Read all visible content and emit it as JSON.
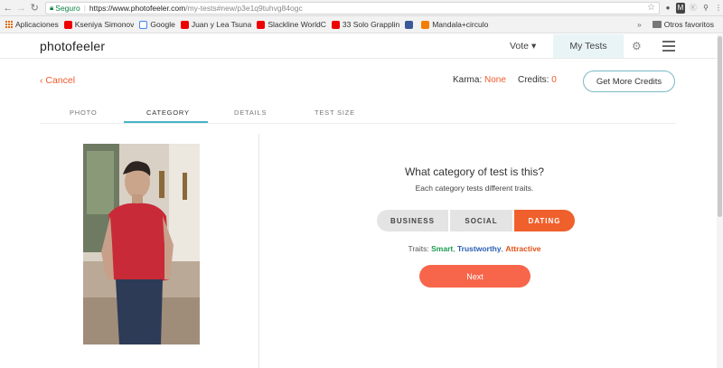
{
  "browser": {
    "secure_label": "Seguro",
    "url_host": "https://www.photofeeler.com",
    "url_path": "/my-tests#new/p3e1q9tuhvg84ogc",
    "bookmarks": [
      {
        "label": "Aplicaciones",
        "icon": "apps-grid-icon"
      },
      {
        "label": "Kseniya Simonov",
        "icon": "youtube-icon"
      },
      {
        "label": "Google",
        "icon": "google-icon"
      },
      {
        "label": "Juan y Lea Tsuna",
        "icon": "youtube-icon"
      },
      {
        "label": "Slackline WorldC",
        "icon": "youtube-icon"
      },
      {
        "label": "33 Solo Grapplin",
        "icon": "youtube-icon"
      },
      {
        "label": "",
        "icon": "facebook-icon"
      },
      {
        "label": "Mandala+circulo",
        "icon": "blogger-icon"
      }
    ],
    "more_chevron": "»",
    "other_bookmarks": "Otros favoritos"
  },
  "header": {
    "brand": "photofeeler",
    "vote": "Vote ▾",
    "my_tests": "My Tests"
  },
  "top": {
    "cancel": "‹ Cancel",
    "karma_label": "Karma:",
    "karma_value": "None",
    "credits_label": "Credits:",
    "credits_value": "0",
    "get_more": "Get More Credits"
  },
  "steps": [
    "PHOTO",
    "CATEGORY",
    "DETAILS",
    "TEST SIZE"
  ],
  "active_step": "CATEGORY",
  "main": {
    "question": "What category of test is this?",
    "subtitle": "Each category tests different traits.",
    "categories": [
      "BUSINESS",
      "SOCIAL",
      "DATING"
    ],
    "selected_category": "DATING",
    "traits_label": "Traits:",
    "traits": [
      "Smart",
      "Trustworthy",
      "Attractive"
    ],
    "next": "Next"
  },
  "colors": {
    "accent": "#f0602c",
    "teal": "#46b3c7",
    "smart": "#1a9a4f",
    "trustworthy": "#2a5fb3",
    "attractive": "#e05016"
  }
}
